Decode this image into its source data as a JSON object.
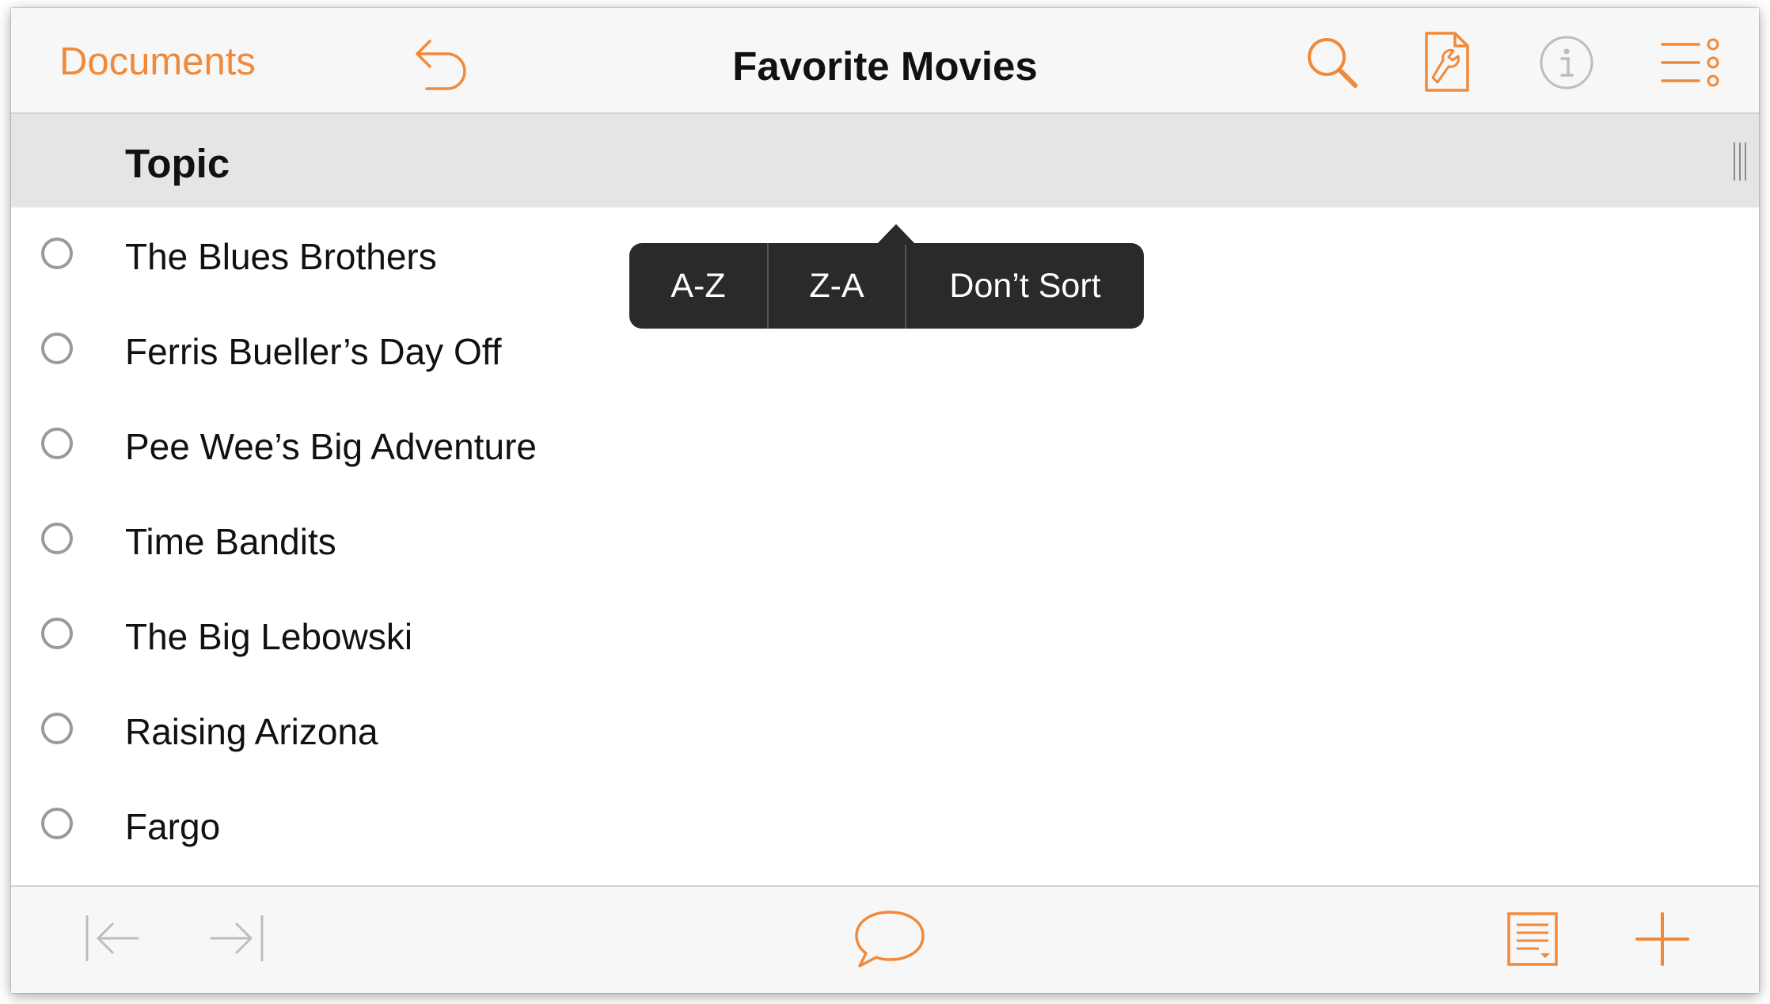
{
  "topbar": {
    "documents_label": "Documents",
    "title": "Favorite Movies",
    "icons": [
      "undo-icon",
      "search-icon",
      "document-settings-icon",
      "info-icon",
      "outline-menu-icon"
    ]
  },
  "header": {
    "column_label": "Topic",
    "icons": [
      "column-resize-handle-icon"
    ]
  },
  "rows": [
    {
      "label": "The Blues Brothers"
    },
    {
      "label": "Ferris Bueller’s Day Off"
    },
    {
      "label": "Pee Wee’s Big Adventure"
    },
    {
      "label": "Time Bandits"
    },
    {
      "label": "The Big Lebowski"
    },
    {
      "label": "Raising Arizona"
    },
    {
      "label": "Fargo"
    }
  ],
  "sort_menu": {
    "items": [
      "A-Z",
      "Z-A",
      "Don’t Sort"
    ]
  },
  "bottombar": {
    "icons": [
      "outdent-icon",
      "indent-icon",
      "comment-icon",
      "note-icon",
      "add-icon"
    ]
  },
  "colors": {
    "accent": "#f08a3a",
    "accent_muted": "#f2a46a",
    "disabled": "#bdbdbd",
    "menu_bg": "#2a2a2a",
    "header_bg": "#e5e5e5",
    "bar_bg": "#f7f7f7",
    "text": "#111111"
  }
}
